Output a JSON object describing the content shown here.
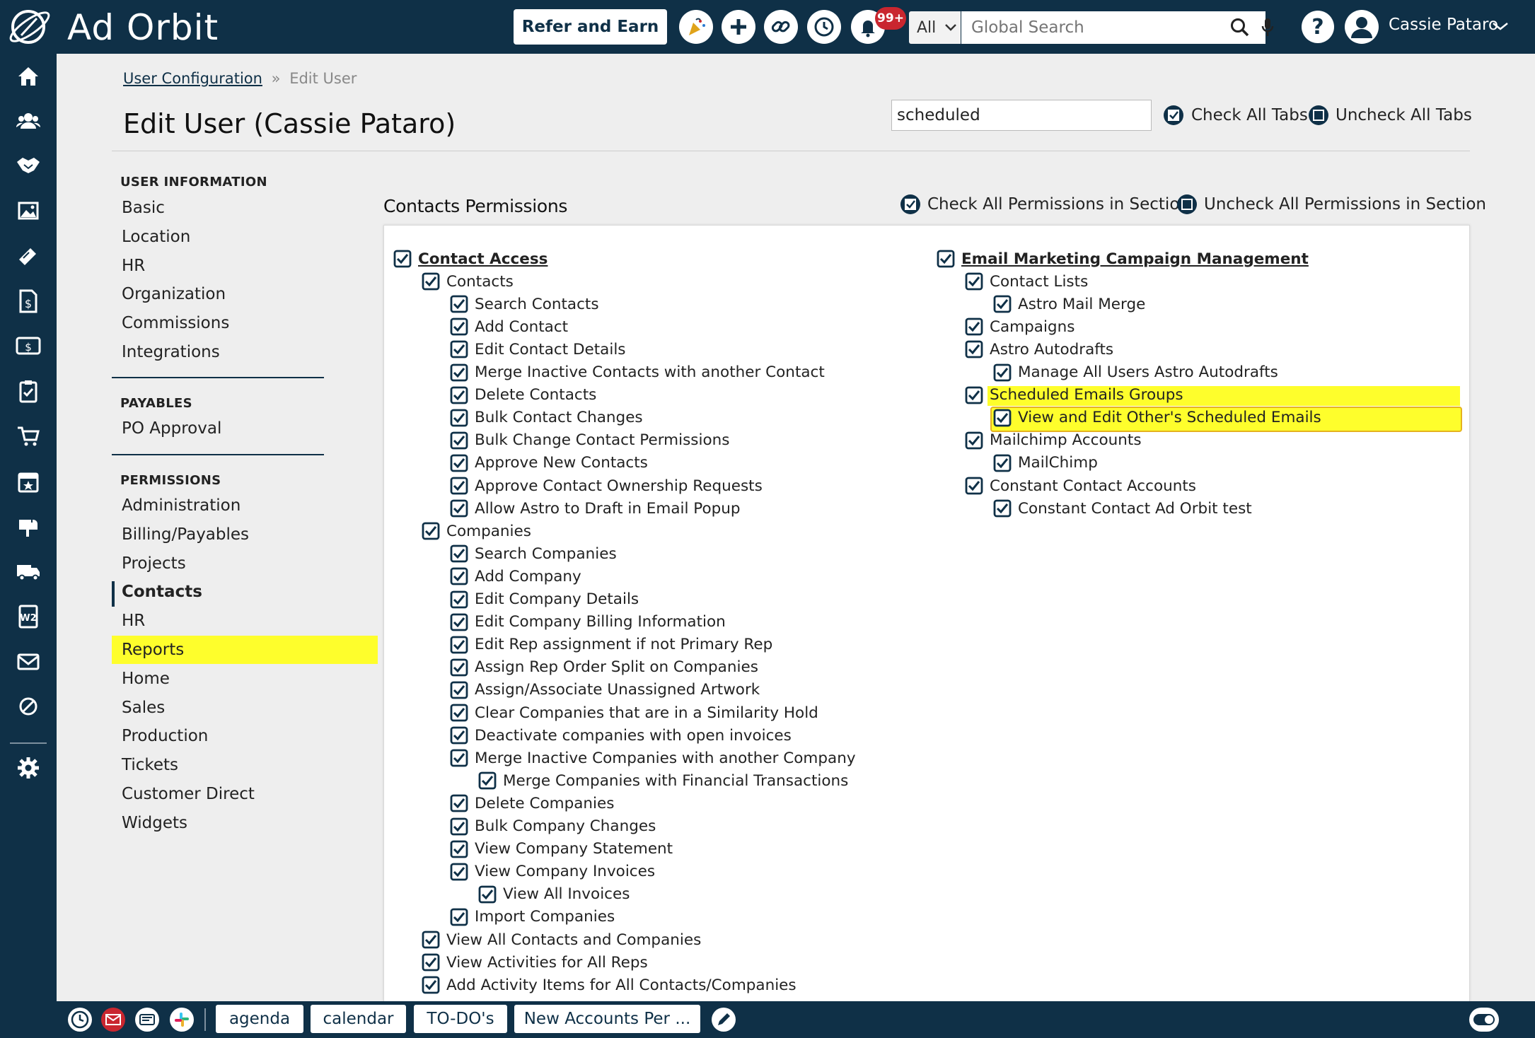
{
  "app": {
    "logo_text": "Ad Orbit"
  },
  "topbar": {
    "refer_label": "Refer and Earn",
    "notif_count": "99+",
    "search_scope": "All",
    "search_placeholder": "Global Search",
    "help_label": "?",
    "user_name": "Cassie Pataro"
  },
  "breadcrumb": {
    "parent": "User Configuration",
    "sep": "»",
    "current": "Edit User"
  },
  "page_title": "Edit User (Cassie Pataro)",
  "filter": {
    "value": "scheduled"
  },
  "tab_controls": {
    "check_all": "Check All Tabs",
    "uncheck_all": "Uncheck All Tabs"
  },
  "left_nav": {
    "user_info": {
      "heading": "USER INFORMATION",
      "items": [
        "Basic",
        "Location",
        "HR",
        "Organization",
        "Commissions",
        "Integrations"
      ]
    },
    "payables": {
      "heading": "PAYABLES",
      "items": [
        "PO Approval"
      ]
    },
    "permissions": {
      "heading": "PERMISSIONS",
      "items": [
        "Administration",
        "Billing/Payables",
        "Projects",
        "Contacts",
        "HR",
        "Reports",
        "Home",
        "Sales",
        "Production",
        "Tickets",
        "Customer Direct",
        "Widgets"
      ],
      "active": "Contacts",
      "highlighted": "Reports"
    }
  },
  "section": {
    "title": "Contacts Permissions",
    "check_all": "Check All Permissions in Section",
    "uncheck_all": "Uncheck All Permissions in Section"
  },
  "perms_left": [
    {
      "label": "Contact Access",
      "level": 0,
      "head": true
    },
    {
      "label": "Contacts",
      "level": 1
    },
    {
      "label": "Search Contacts",
      "level": 2
    },
    {
      "label": "Add Contact",
      "level": 2
    },
    {
      "label": "Edit Contact Details",
      "level": 2
    },
    {
      "label": "Merge Inactive Contacts with another Contact",
      "level": 2
    },
    {
      "label": "Delete Contacts",
      "level": 2
    },
    {
      "label": "Bulk Contact Changes",
      "level": 2
    },
    {
      "label": "Bulk Change Contact Permissions",
      "level": 2
    },
    {
      "label": "Approve New Contacts",
      "level": 2
    },
    {
      "label": "Approve Contact Ownership Requests",
      "level": 2
    },
    {
      "label": "Allow Astro to Draft in Email Popup",
      "level": 2
    },
    {
      "label": "Companies",
      "level": 1
    },
    {
      "label": "Search Companies",
      "level": 2
    },
    {
      "label": "Add Company",
      "level": 2
    },
    {
      "label": "Edit Company Details",
      "level": 2
    },
    {
      "label": "Edit Company Billing Information",
      "level": 2
    },
    {
      "label": "Edit Rep assignment if not Primary Rep",
      "level": 2
    },
    {
      "label": "Assign Rep Order Split on Companies",
      "level": 2
    },
    {
      "label": "Assign/Associate Unassigned Artwork",
      "level": 2
    },
    {
      "label": "Clear Companies that are in a Similarity Hold",
      "level": 2
    },
    {
      "label": "Deactivate companies with open invoices",
      "level": 2
    },
    {
      "label": "Merge Inactive Companies with another Company",
      "level": 2
    },
    {
      "label": "Merge Companies with Financial Transactions",
      "level": 3
    },
    {
      "label": "Delete Companies",
      "level": 2
    },
    {
      "label": "Bulk Company Changes",
      "level": 2
    },
    {
      "label": "View Company Statement",
      "level": 2
    },
    {
      "label": "View Company Invoices",
      "level": 2
    },
    {
      "label": "View All Invoices",
      "level": 3
    },
    {
      "label": "Import Companies",
      "level": 2
    },
    {
      "label": "View All Contacts and Companies",
      "level": 1
    },
    {
      "label": "View Activities for All Reps",
      "level": 1
    },
    {
      "label": "Add Activity Items for All Contacts/Companies",
      "level": 1
    }
  ],
  "perms_right": [
    {
      "label": "Email Marketing Campaign Management",
      "level": 0,
      "head": true
    },
    {
      "label": "Contact Lists",
      "level": 1
    },
    {
      "label": "Astro Mail Merge",
      "level": 2
    },
    {
      "label": "Campaigns",
      "level": 1
    },
    {
      "label": "Astro Autodrafts",
      "level": 1
    },
    {
      "label": "Manage All Users Astro Autodrafts",
      "level": 2
    },
    {
      "label": "Scheduled Emails Groups",
      "level": 1
    },
    {
      "label": "View and Edit Other's Scheduled Emails",
      "level": 2
    },
    {
      "label": "Mailchimp Accounts",
      "level": 1
    },
    {
      "label": "MailChimp",
      "level": 2
    },
    {
      "label": "Constant Contact Accounts",
      "level": 1
    },
    {
      "label": "Constant Contact Ad Orbit test",
      "level": 2
    }
  ],
  "bottom_tabs": [
    "agenda",
    "calendar",
    "TO-DO's",
    "New Accounts Per ..."
  ],
  "colors": {
    "navy": "#0f3047",
    "highlight": "#fefe2c",
    "highlight_border": "#e5b21f",
    "badge": "#c9262f"
  }
}
